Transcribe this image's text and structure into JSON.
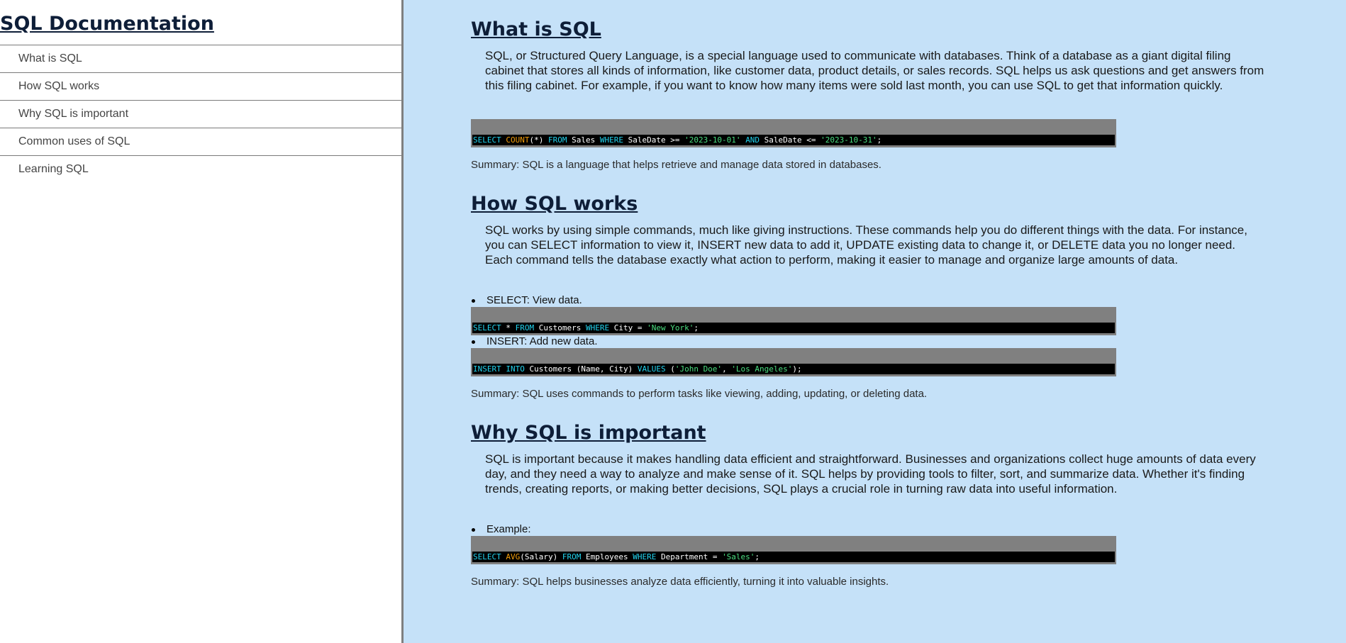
{
  "sidebar": {
    "title": "SQL Documentation",
    "items": [
      {
        "label": "What is SQL"
      },
      {
        "label": "How SQL works"
      },
      {
        "label": "Why SQL is important"
      },
      {
        "label": "Common uses of SQL"
      },
      {
        "label": "Learning SQL"
      }
    ]
  },
  "colors": {
    "main_background": "#c5e1f8",
    "code_keyword": "#22d3ee",
    "code_function": "#f59e0b",
    "code_string": "#4ade80"
  },
  "sections": [
    {
      "title": "What is SQL",
      "description": "SQL, or Structured Query Language, is a special language used to communicate with databases. Think of a database as a giant digital filing cabinet that stores all kinds of information, like customer data, product details, or sales records. SQL helps us ask questions and get answers from this filing cabinet. For example, if you want to know how many items were sold last month, you can use SQL to get that information quickly.",
      "code": {
        "kw1": "SELECT",
        "fn1": "COUNT",
        "t1": "(*) ",
        "kw2": "FROM",
        "t2": " Sales ",
        "kw3": "WHERE",
        "t3": " SaleDate >= ",
        "s1": "'2023-10-01'",
        "t4": " ",
        "kw4": "AND",
        "t5": " SaleDate <= ",
        "s2": "'2023-10-31'",
        "t6": ";"
      },
      "summary": "Summary: SQL is a language that helps retrieve and manage data stored in databases."
    },
    {
      "title": "How SQL works",
      "description": "SQL works by using simple commands, much like giving instructions. These commands help you do different things with the data. For instance, you can SELECT information to view it, INSERT new data to add it, UPDATE existing data to change it, or DELETE data you no longer need. Each command tells the database exactly what action to perform, making it easier to manage and organize large amounts of data.",
      "bullets": [
        {
          "text": "SELECT: View data.",
          "code": {
            "kw1": "SELECT",
            "t1": " * ",
            "kw2": "FROM",
            "t2": " Customers ",
            "kw3": "WHERE",
            "t3": " City = ",
            "s1": "'New York'",
            "t4": ";"
          }
        },
        {
          "text": "INSERT: Add new data.",
          "code": {
            "kw1": "INSERT",
            "t1": " ",
            "kw2": "INTO",
            "t2": " Customers (Name, City) ",
            "kw3": "VALUES",
            "t3": " (",
            "s1": "'John Doe'",
            "t4": ", ",
            "s2": "'Los Angeles'",
            "t5": ");"
          }
        }
      ],
      "summary": "Summary: SQL uses commands to perform tasks like viewing, adding, updating, or deleting data."
    },
    {
      "title": "Why SQL is important",
      "description": "SQL is important because it makes handling data efficient and straightforward. Businesses and organizations collect huge amounts of data every day, and they need a way to analyze and make sense of it. SQL helps by providing tools to filter, sort, and summarize data. Whether it's finding trends, creating reports, or making better decisions, SQL plays a crucial role in turning raw data into useful information.",
      "bullets": [
        {
          "text": "Example:",
          "code": {
            "kw1": "SELECT",
            "t1": " ",
            "fn1": "AVG",
            "t2": "(Salary) ",
            "kw2": "FROM",
            "t3": " Employees ",
            "kw3": "WHERE",
            "t4": " Department = ",
            "s1": "'Sales'",
            "t5": ";"
          }
        }
      ],
      "summary": "Summary: SQL helps businesses analyze data efficiently, turning it into valuable insights."
    }
  ]
}
